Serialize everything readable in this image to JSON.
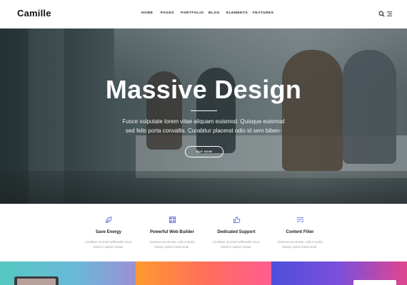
{
  "header": {
    "logo": "Camille",
    "nav": [
      "HOME",
      "PAGES",
      "PORTFOLIO",
      "BLOG",
      "ELEMENTS",
      "FEATURES"
    ],
    "icons": [
      "search-icon",
      "menu-icon"
    ]
  },
  "hero": {
    "title": "Massive Design",
    "subtitle_line1": "Fusce vulputate lorem vitae aliquam euismod. Quisque euismod",
    "subtitle_line2": "sed felis porta convallis. Curabitur placerat odio id sem biben-",
    "button": "BUY NOW"
  },
  "features": [
    {
      "icon": "leaf-icon",
      "title": "Save Energy",
      "line1": "Curabitur sit amet sollicitudin risus.",
      "line2": "Morbi in sapien neque."
    },
    {
      "icon": "grid-icon",
      "title": "Powerful Web Builder",
      "line1": "Vivamus accumsan, odio et porta",
      "line2": "lacinia, purus metus ante."
    },
    {
      "icon": "thumbs-up-icon",
      "title": "Dedicated Support",
      "line1": "Curabitur sit amet sollicitudin risus.",
      "line2": "Morbi in sapien neque."
    },
    {
      "icon": "checklist-icon",
      "title": "Content Filter",
      "line1": "Vivamus accumsan, odio et porta",
      "line2": "lacinia, purus metus ante."
    }
  ],
  "colors": {
    "icon_accent": "#4a5bd6",
    "strip1": "#55c8c0",
    "strip2": "#ff6f5a",
    "strip3": "#7b4fd9"
  }
}
